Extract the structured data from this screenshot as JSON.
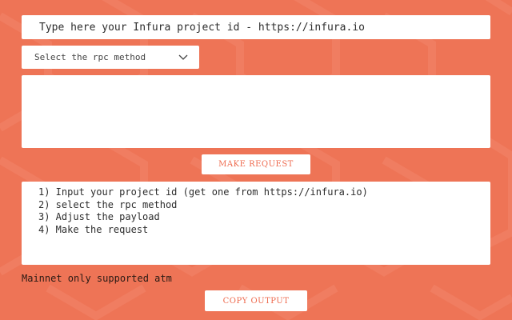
{
  "project_id_input": {
    "placeholder": "Type here your Infura project id - https://infura.io",
    "value": ""
  },
  "rpc_method_select": {
    "selected_label": "Select the rpc method",
    "chevron_icon": "chevron-down-icon"
  },
  "payload_textarea": {
    "value": ""
  },
  "make_request_button": {
    "label": "MAKE REQUEST"
  },
  "output": {
    "lines": [
      "1) Input your project id (get one from https://infura.io)",
      "2) select the rpc method",
      "3) Adjust the payload",
      "4) Make the request"
    ]
  },
  "network_note": "Mainnet only supported atm",
  "copy_output_button": {
    "label": "COPY OUTPUT"
  },
  "colors": {
    "background": "#ee7456",
    "panel": "#ffffff",
    "button_text": "#ee6a4e"
  }
}
